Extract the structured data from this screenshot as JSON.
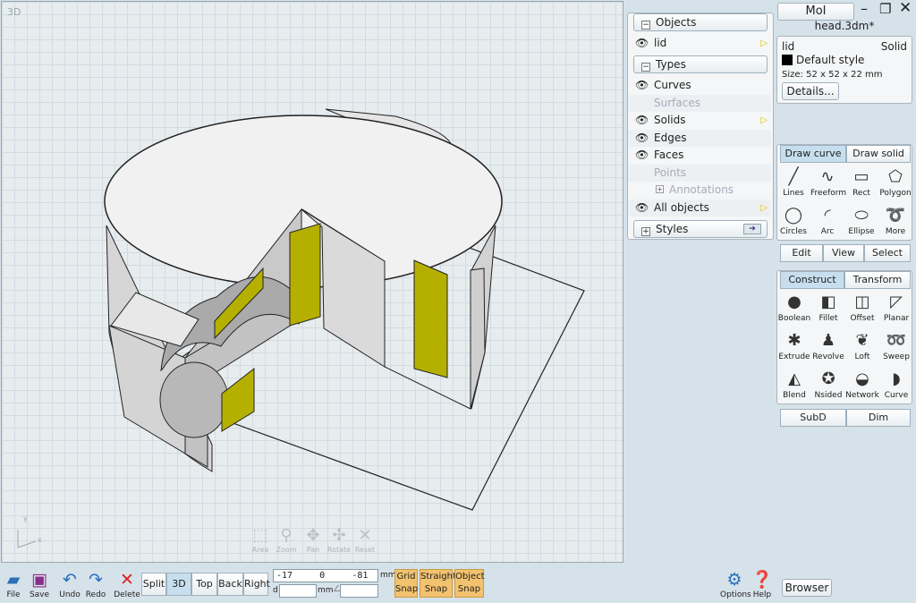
{
  "viewport": {
    "label": "3D",
    "nav": [
      {
        "name": "area",
        "label": "Area",
        "icon": "area-zoom-icon"
      },
      {
        "name": "zoom",
        "label": "Zoom",
        "icon": "zoom-icon"
      },
      {
        "name": "pan",
        "label": "Pan",
        "icon": "pan-icon"
      },
      {
        "name": "rotate",
        "label": "Rotate",
        "icon": "rotate-icon"
      },
      {
        "name": "reset",
        "label": "Reset",
        "icon": "reset-icon"
      }
    ]
  },
  "scene": {
    "axis_y": "y",
    "axis_x": "x"
  },
  "objects_panel": {
    "objects_header": "Objects",
    "object_item": "lid",
    "types_header": "Types",
    "types": [
      {
        "label": "Curves",
        "visible": true,
        "enabled": true
      },
      {
        "label": "Surfaces",
        "visible": false,
        "enabled": false
      },
      {
        "label": "Solids",
        "visible": true,
        "enabled": true,
        "arrow": true
      },
      {
        "label": "Edges",
        "visible": true,
        "enabled": true
      },
      {
        "label": "Faces",
        "visible": true,
        "enabled": true
      },
      {
        "label": "Points",
        "visible": false,
        "enabled": false
      },
      {
        "label": "Annotations",
        "visible": false,
        "enabled": false,
        "expand": true
      }
    ],
    "all_objects": "All objects",
    "styles": "Styles"
  },
  "app": {
    "title": "MoI",
    "filename": "head.3dm*"
  },
  "properties": {
    "name": "lid",
    "type": "Solid",
    "style": "Default style",
    "size": "Size: 52 x 52 x 22 mm",
    "details": "Details..."
  },
  "draw_tabs": {
    "tab1": "Draw curve",
    "tab2": "Draw solid"
  },
  "draw_tools": [
    {
      "label": "Lines",
      "icon": "line-icon",
      "glyph": "╱"
    },
    {
      "label": "Freeform",
      "icon": "freeform-icon",
      "glyph": "∿"
    },
    {
      "label": "Rect",
      "icon": "rectangle-icon",
      "glyph": "▭"
    },
    {
      "label": "Polygon",
      "icon": "polygon-icon",
      "glyph": "⬠"
    },
    {
      "label": "Circles",
      "icon": "circle-icon",
      "glyph": "◯"
    },
    {
      "label": "Arc",
      "icon": "arc-icon",
      "glyph": "◜"
    },
    {
      "label": "Ellipse",
      "icon": "ellipse-icon",
      "glyph": "⬭"
    },
    {
      "label": "More",
      "icon": "more-icon",
      "glyph": "➰"
    }
  ],
  "mode_tabs": {
    "edit": "Edit",
    "view": "View",
    "select": "Select"
  },
  "construct_tabs": {
    "tab1": "Construct",
    "tab2": "Transform"
  },
  "construct_tools": [
    {
      "label": "Boolean",
      "icon": "boolean-icon",
      "glyph": "●"
    },
    {
      "label": "Fillet",
      "icon": "fillet-icon",
      "glyph": "◧"
    },
    {
      "label": "Offset",
      "icon": "offset-icon",
      "glyph": "◫"
    },
    {
      "label": "Planar",
      "icon": "planar-icon",
      "glyph": "◸"
    },
    {
      "label": "Extrude",
      "icon": "extrude-icon",
      "glyph": "✱"
    },
    {
      "label": "Revolve",
      "icon": "revolve-icon",
      "glyph": "♟"
    },
    {
      "label": "Loft",
      "icon": "loft-icon",
      "glyph": "❦"
    },
    {
      "label": "Sweep",
      "icon": "sweep-icon",
      "glyph": "➿"
    },
    {
      "label": "Blend",
      "icon": "blend-icon",
      "glyph": "◭"
    },
    {
      "label": "Nsided",
      "icon": "nsided-icon",
      "glyph": "✪"
    },
    {
      "label": "Network",
      "icon": "network-icon",
      "glyph": "◒"
    },
    {
      "label": "Curve",
      "icon": "curve-icon",
      "glyph": "◗"
    }
  ],
  "subd_tabs": {
    "subd": "SubD",
    "dim": "Dim"
  },
  "bottom": {
    "file": "File",
    "save": "Save",
    "undo": "Undo",
    "redo": "Redo",
    "delete": "Delete",
    "views": {
      "split": "Split",
      "3d": "3D",
      "top": "Top",
      "back": "Back",
      "right": "Right"
    },
    "coord_x": "-17",
    "coord_y": "0",
    "coord_z": "-81",
    "unit": "mm",
    "d_label": "d",
    "angle_label": "∠",
    "grid_snap": [
      "Grid",
      "Snap"
    ],
    "straight_snap": [
      "Straight",
      "Snap"
    ],
    "object_snap": [
      "Object",
      "Snap"
    ],
    "options": "Options",
    "help": "Help",
    "browser": "Browser"
  },
  "colors": {
    "accent": "#c7deef",
    "snap": "#f2c26e",
    "face_highlight": "#b5b000"
  }
}
